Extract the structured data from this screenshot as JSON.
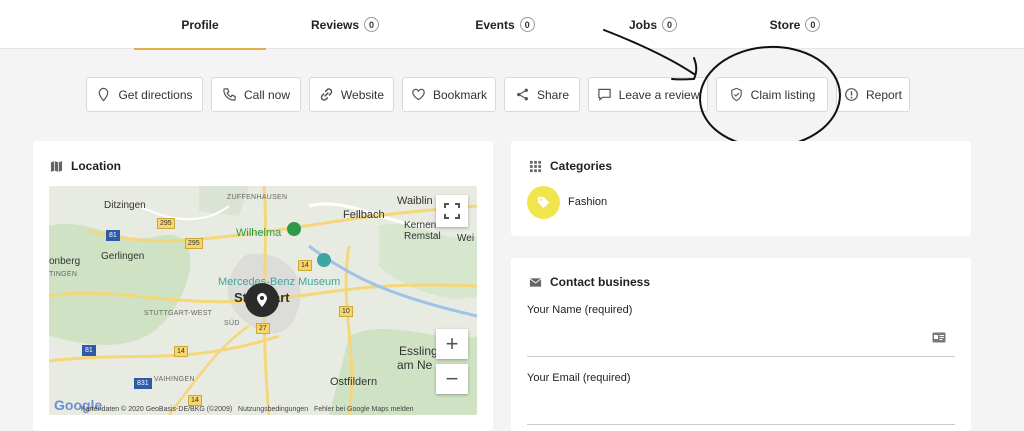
{
  "tabs": [
    {
      "label": "Profile",
      "count": null,
      "active": true
    },
    {
      "label": "Reviews",
      "count": "0",
      "active": false
    },
    {
      "label": "Events",
      "count": "0",
      "active": false
    },
    {
      "label": "Jobs",
      "count": "0",
      "active": false
    },
    {
      "label": "Store",
      "count": "0",
      "active": false
    }
  ],
  "actions": [
    {
      "label": "Get directions",
      "icon": "map-pin-icon"
    },
    {
      "label": "Call now",
      "icon": "phone-icon"
    },
    {
      "label": "Website",
      "icon": "link-icon"
    },
    {
      "label": "Bookmark",
      "icon": "heart-icon"
    },
    {
      "label": "Share",
      "icon": "share-icon"
    },
    {
      "label": "Leave a review",
      "icon": "comment-icon"
    },
    {
      "label": "Claim listing",
      "icon": "shield-check-icon"
    },
    {
      "label": "Report",
      "icon": "alert-circle-icon"
    }
  ],
  "location": {
    "title": "Location",
    "map": {
      "labels": {
        "zuffenhausen": "ZUFFENHAUSEN",
        "ditzingen": "Ditzingen",
        "fellbach": "Fellbach",
        "waiblingen": "Waiblin",
        "kernen": "Kernen",
        "remstal": "Remstal",
        "weinstadt": "Wei",
        "wilhelma": "Wilhelma",
        "onberg": "onberg",
        "tingen": "TINGEN",
        "gerlingen": "Gerlingen",
        "museum": "Mercedes-Benz Museum",
        "stuttgart_a": "St",
        "stuttgart_b": "art",
        "stuttgart_west": "STUTTGART-WEST",
        "sud": "SÜD",
        "esslingen_a": "Essling",
        "esslingen_b": "am Ne",
        "ostfildern": "Ostfildern",
        "vaihingen": "VAIHINGEN"
      },
      "roads": [
        "295",
        "295",
        "81",
        "14",
        "10",
        "27",
        "81",
        "14",
        "831",
        "14"
      ],
      "zoom_in": "+",
      "zoom_out": "−",
      "logo": "Google",
      "attribution": "Kartendaten © 2020 GeoBasis-DE/BKG (©2009)",
      "terms": "Nutzungsbedingungen",
      "report_error": "Fehler bei Google Maps melden"
    }
  },
  "categories": {
    "title": "Categories",
    "items": [
      {
        "label": "Fashion",
        "color": "#f1e44c"
      }
    ]
  },
  "contact": {
    "title": "Contact business",
    "fields": [
      {
        "label": "Your Name (required)"
      },
      {
        "label": "Your Email (required)"
      }
    ]
  },
  "colors": {
    "accent": "#e6ad4d",
    "category": "#f1e44c"
  }
}
